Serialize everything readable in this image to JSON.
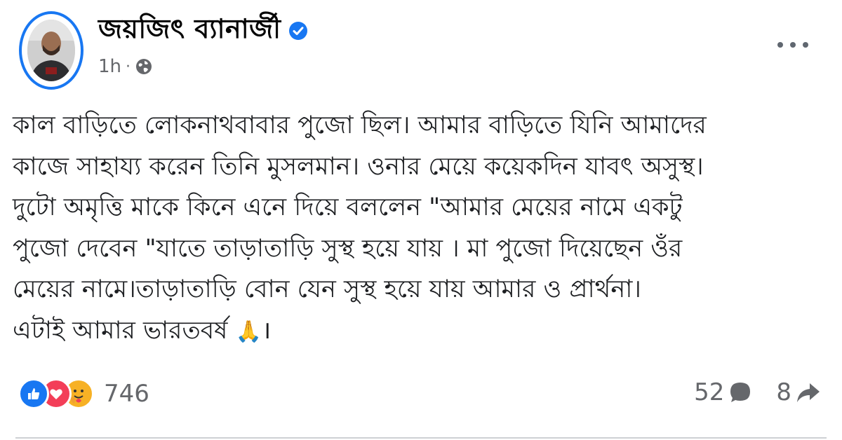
{
  "author": {
    "name": "জয়জিৎ ব্যানার্জী",
    "verified": true,
    "avatar_icon": "profile-photo"
  },
  "meta": {
    "time": "1h",
    "separator": "·",
    "audience_icon": "globe-icon"
  },
  "post": {
    "lines": [
      "কাল বাড়িতে লোকনাথবাবার পুজো ছিল। আমার বাড়িতে যিনি আমাদের",
      "কাজে সাহায্য করেন তিনি মুসলমান। ওনার মেয়ে কয়েকদিন যাবৎ অসুস্থ।",
      "দুটো অমৃত্তি মাকে কিনে এনে দিয়ে বললেন \"আমার মেয়ের নামে একটু",
      "পুজো দেবেন \"যাতে তাড়াতাড়ি সুস্থ হয়ে যায় । মা পুজো দিয়েছেন ওঁর",
      "মেয়ের নামে।তাড়াতাড়ি বোন যেন সুস্থ হয়ে যায় আমার ও প্রার্থনা।"
    ],
    "last_line_text": "এটাই আমার ভারতবর্ষ",
    "last_line_emoji": "🙏",
    "last_line_end": "।"
  },
  "reactions": {
    "types": [
      "like",
      "love",
      "care"
    ],
    "count": "746"
  },
  "engagement": {
    "comments": "52",
    "shares": "8"
  },
  "colors": {
    "accent": "#1877f2",
    "meta_text": "#65676b",
    "love": "#f33e58",
    "care": "#f7b125"
  }
}
